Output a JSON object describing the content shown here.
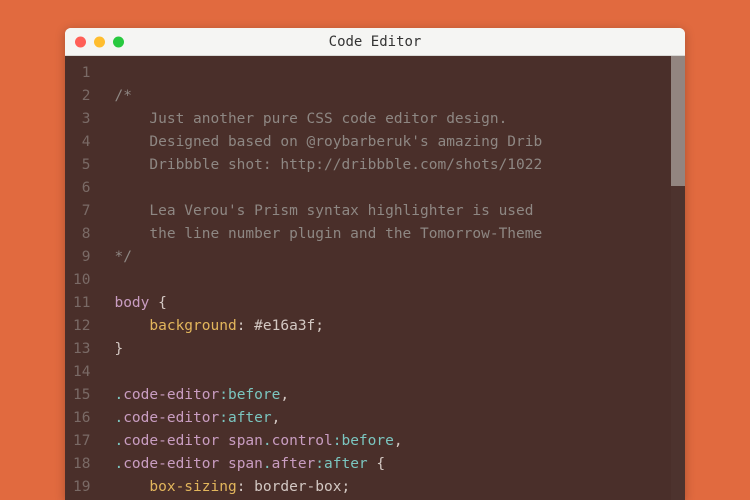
{
  "window": {
    "title": "Code Editor"
  },
  "gutter": {
    "start": 1,
    "end": 19
  },
  "code": {
    "lines": [
      {
        "n": 1,
        "tokens": []
      },
      {
        "n": 2,
        "tokens": [
          {
            "t": "/*",
            "c": "comment"
          }
        ]
      },
      {
        "n": 3,
        "tokens": [
          {
            "t": "    Just another pure CSS code editor design.",
            "c": "comment"
          }
        ]
      },
      {
        "n": 4,
        "tokens": [
          {
            "t": "    Designed based on @roybarberuk's amazing Drib",
            "c": "comment"
          }
        ]
      },
      {
        "n": 5,
        "tokens": [
          {
            "t": "    Dribbble shot: http://dribbble.com/shots/1022",
            "c": "comment"
          }
        ]
      },
      {
        "n": 6,
        "tokens": []
      },
      {
        "n": 7,
        "tokens": [
          {
            "t": "    Lea Verou's Prism syntax highlighter is used",
            "c": "comment"
          }
        ]
      },
      {
        "n": 8,
        "tokens": [
          {
            "t": "    the line number plugin and the Tomorrow-Theme",
            "c": "comment"
          }
        ]
      },
      {
        "n": 9,
        "tokens": [
          {
            "t": "*/",
            "c": "comment"
          }
        ]
      },
      {
        "n": 10,
        "tokens": []
      },
      {
        "n": 11,
        "tokens": [
          {
            "t": "body ",
            "c": "selector"
          },
          {
            "t": "{",
            "c": "brace"
          }
        ]
      },
      {
        "n": 12,
        "tokens": [
          {
            "t": "    ",
            "c": "punct"
          },
          {
            "t": "background",
            "c": "property"
          },
          {
            "t": ": ",
            "c": "punct"
          },
          {
            "t": "#e16a3f",
            "c": "value"
          },
          {
            "t": ";",
            "c": "punct"
          }
        ]
      },
      {
        "n": 13,
        "tokens": [
          {
            "t": "}",
            "c": "brace"
          }
        ]
      },
      {
        "n": 14,
        "tokens": []
      },
      {
        "n": 15,
        "tokens": [
          {
            "t": ".",
            "c": "dot"
          },
          {
            "t": "code-editor",
            "c": "class"
          },
          {
            "t": ":before",
            "c": "pseudo"
          },
          {
            "t": ",",
            "c": "punct"
          }
        ]
      },
      {
        "n": 16,
        "tokens": [
          {
            "t": ".",
            "c": "dot"
          },
          {
            "t": "code-editor",
            "c": "class"
          },
          {
            "t": ":after",
            "c": "pseudo"
          },
          {
            "t": ",",
            "c": "punct"
          }
        ]
      },
      {
        "n": 17,
        "tokens": [
          {
            "t": ".",
            "c": "dot"
          },
          {
            "t": "code-editor ",
            "c": "class"
          },
          {
            "t": "span",
            "c": "selector"
          },
          {
            "t": ".",
            "c": "dot"
          },
          {
            "t": "control",
            "c": "class"
          },
          {
            "t": ":before",
            "c": "pseudo"
          },
          {
            "t": ",",
            "c": "punct"
          }
        ]
      },
      {
        "n": 18,
        "tokens": [
          {
            "t": ".",
            "c": "dot"
          },
          {
            "t": "code-editor ",
            "c": "class"
          },
          {
            "t": "span",
            "c": "selector"
          },
          {
            "t": ".",
            "c": "dot"
          },
          {
            "t": "after",
            "c": "class"
          },
          {
            "t": ":after",
            "c": "pseudo"
          },
          {
            "t": " {",
            "c": "brace"
          }
        ]
      },
      {
        "n": 19,
        "tokens": [
          {
            "t": "    ",
            "c": "punct"
          },
          {
            "t": "box-sizing",
            "c": "property"
          },
          {
            "t": ": ",
            "c": "punct"
          },
          {
            "t": "border-box",
            "c": "value"
          },
          {
            "t": ";",
            "c": "punct"
          }
        ]
      }
    ]
  }
}
